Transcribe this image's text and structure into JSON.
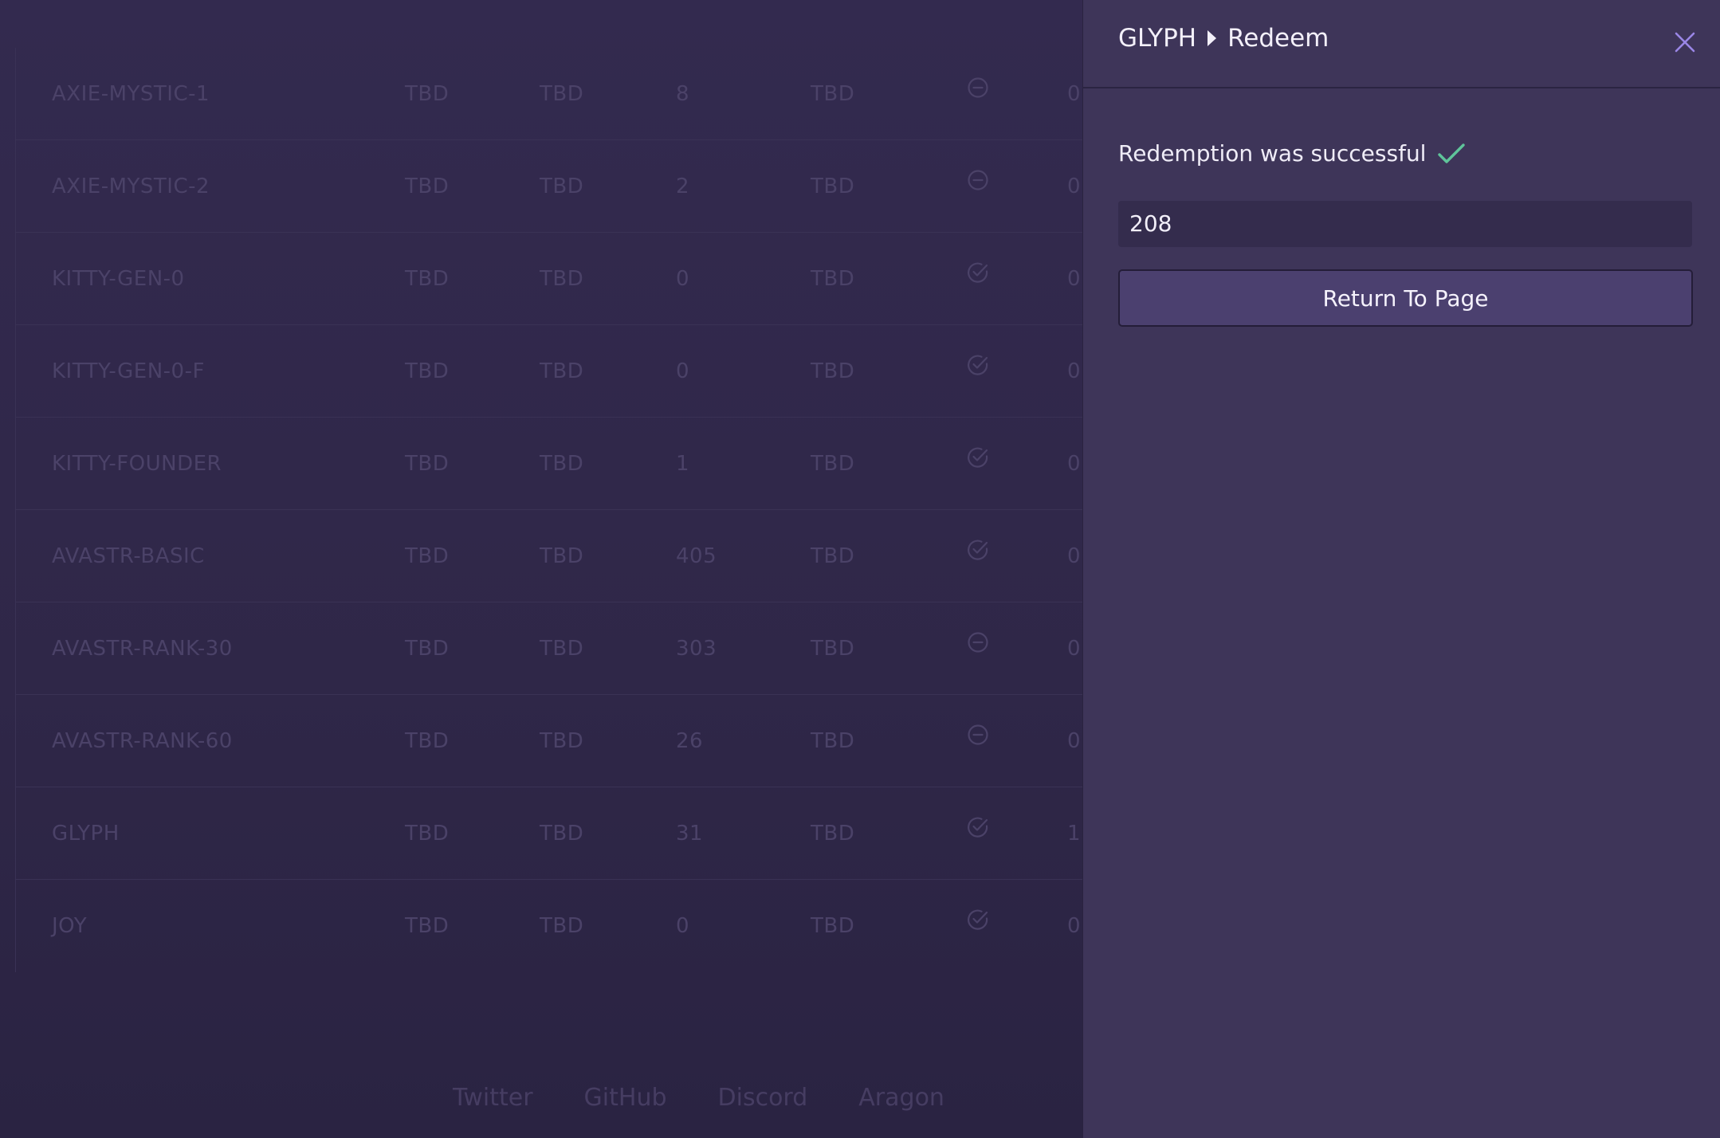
{
  "table": {
    "rows": [
      {
        "name": "AXIE-MYSTIC-1",
        "a": "TBD",
        "b": "TBD",
        "c": "8",
        "d": "TBD",
        "status": "minus",
        "e": "0"
      },
      {
        "name": "AXIE-MYSTIC-2",
        "a": "TBD",
        "b": "TBD",
        "c": "2",
        "d": "TBD",
        "status": "minus",
        "e": "0"
      },
      {
        "name": "KITTY-GEN-0",
        "a": "TBD",
        "b": "TBD",
        "c": "0",
        "d": "TBD",
        "status": "check",
        "e": "0"
      },
      {
        "name": "KITTY-GEN-0-F",
        "a": "TBD",
        "b": "TBD",
        "c": "0",
        "d": "TBD",
        "status": "check",
        "e": "0"
      },
      {
        "name": "KITTY-FOUNDER",
        "a": "TBD",
        "b": "TBD",
        "c": "1",
        "d": "TBD",
        "status": "check",
        "e": "0"
      },
      {
        "name": "AVASTR-BASIC",
        "a": "TBD",
        "b": "TBD",
        "c": "405",
        "d": "TBD",
        "status": "check",
        "e": "0"
      },
      {
        "name": "AVASTR-RANK-30",
        "a": "TBD",
        "b": "TBD",
        "c": "303",
        "d": "TBD",
        "status": "minus",
        "e": "0"
      },
      {
        "name": "AVASTR-RANK-60",
        "a": "TBD",
        "b": "TBD",
        "c": "26",
        "d": "TBD",
        "status": "minus",
        "e": "0"
      },
      {
        "name": "GLYPH",
        "a": "TBD",
        "b": "TBD",
        "c": "31",
        "d": "TBD",
        "status": "check",
        "e": "1"
      },
      {
        "name": "JOY",
        "a": "TBD",
        "b": "TBD",
        "c": "0",
        "d": "TBD",
        "status": "check",
        "e": "0"
      }
    ]
  },
  "footer": {
    "links": [
      "Twitter",
      "GitHub",
      "Discord",
      "Aragon"
    ]
  },
  "panel": {
    "breadcrumb": {
      "parent": "GLYPH",
      "current": "Redeem"
    },
    "close_icon": "close-icon",
    "success_text": "Redemption was successful",
    "success_icon": "check-icon",
    "value": "208",
    "return_label": "Return To Page"
  },
  "colors": {
    "accent": "#9a86e6",
    "success": "#5fc49a",
    "panel_bg": "#3e3559",
    "page_bg": "#302848"
  }
}
